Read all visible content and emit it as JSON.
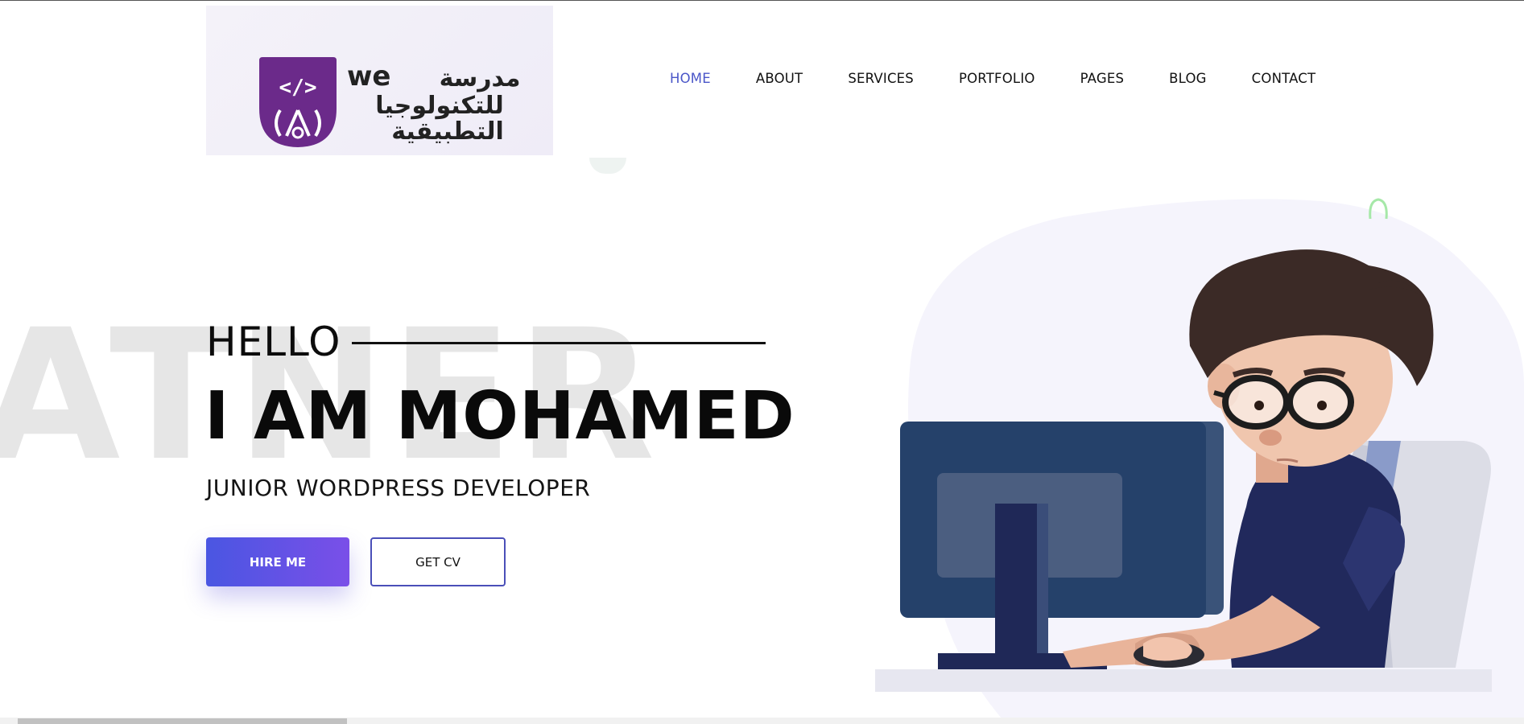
{
  "header": {
    "logo": {
      "brand_text": "we",
      "arabic_line1": "مدرسة",
      "arabic_line2": "للتكنولوجيا",
      "arabic_line3": "التطبيقية",
      "badge_symbol": "</>"
    },
    "nav": [
      {
        "label": "HOME",
        "active": true
      },
      {
        "label": "ABOUT",
        "active": false
      },
      {
        "label": "SERVICES",
        "active": false
      },
      {
        "label": "PORTFOLIO",
        "active": false
      },
      {
        "label": "PAGES",
        "active": false
      },
      {
        "label": "BLOG",
        "active": false
      },
      {
        "label": "CONTACT",
        "active": false
      }
    ]
  },
  "hero": {
    "watermark": "ATNER",
    "hello": "HELLO",
    "headline": "I AM MOHAMED",
    "subtitle": "JUNIOR WORDPRESS DEVELOPER",
    "hire_button": "HIRE ME",
    "cv_button": "GET CV"
  },
  "colors": {
    "accent": "#4a56c8",
    "button_gradient_start": "#4a56e2",
    "button_gradient_end": "#7a4fe8",
    "logo_purple": "#6b2a8a"
  },
  "icons": {
    "illustration": "developer-at-computer-illustration"
  }
}
